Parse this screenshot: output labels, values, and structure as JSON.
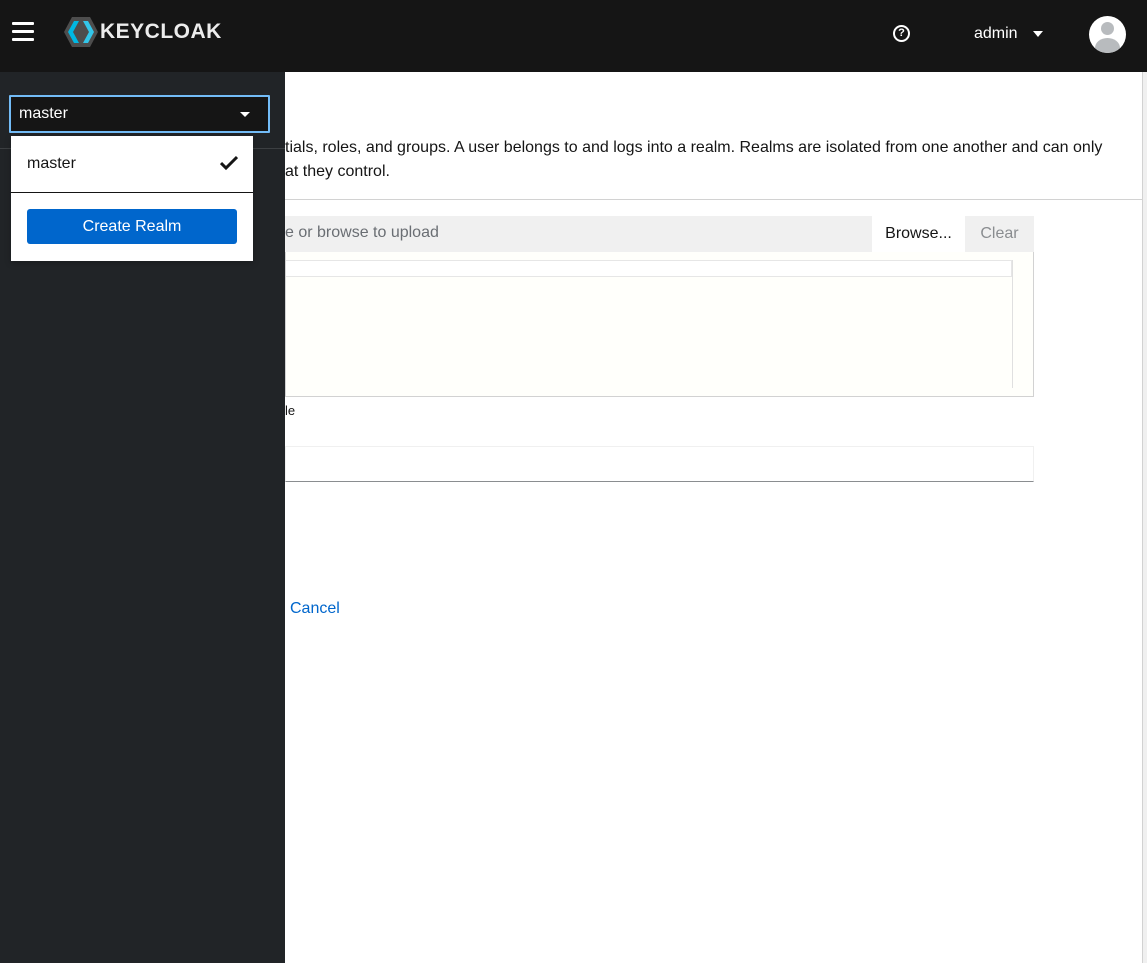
{
  "header": {
    "logo_text": "KEYCLOAK",
    "help_icon": "?",
    "user_name": "admin"
  },
  "sidebar": {
    "realm_selector_value": "master",
    "realm_menu": {
      "items": [
        {
          "label": "master",
          "selected": true
        }
      ],
      "create_button_label": "Create Realm"
    }
  },
  "main": {
    "description_line1": "tials, roles, and groups. A user belongs to and logs into a realm. Realms are isolated from one another and can only",
    "description_line2": "at they control.",
    "upload": {
      "placeholder": "e or browse to upload",
      "browse_label": "Browse...",
      "clear_label": "Clear"
    },
    "helper_text": "le",
    "cancel_label": "Cancel"
  },
  "colors": {
    "masthead_bg": "#151515",
    "sidebar_bg": "#212427",
    "primary": "#0066cc",
    "focus_border": "#73bcf7"
  }
}
